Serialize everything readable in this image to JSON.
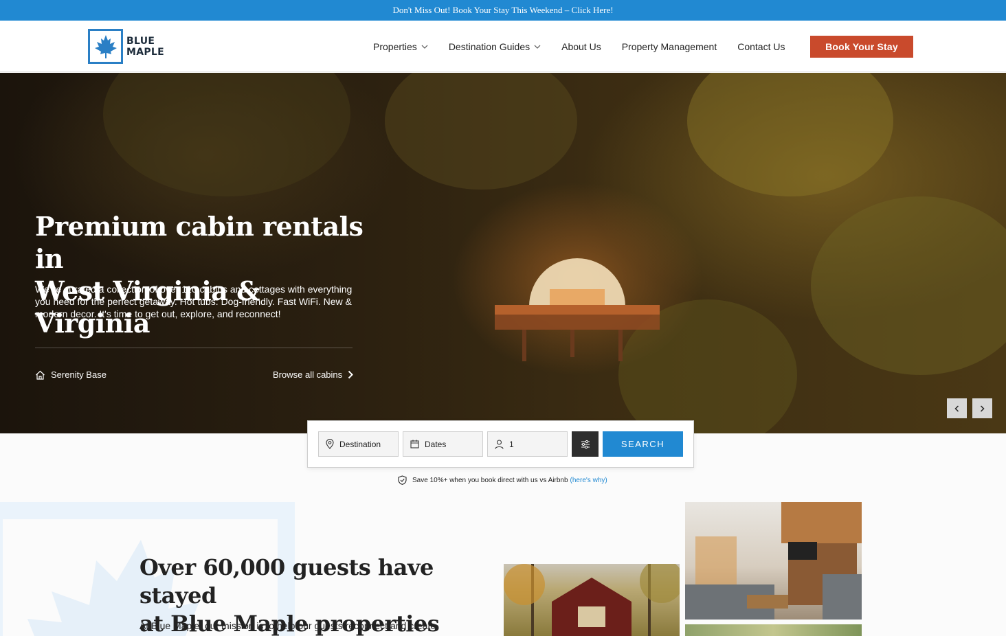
{
  "promo": {
    "text": "Don't Miss Out! Book Your Stay This Weekend – Click Here!"
  },
  "brand": {
    "line1": "BLUE",
    "line2": "MAPLE",
    "accent": "#2a7fc5"
  },
  "nav": {
    "items": [
      {
        "label": "Properties",
        "dropdown": true
      },
      {
        "label": "Destination Guides",
        "dropdown": true
      },
      {
        "label": "About Us",
        "dropdown": false
      },
      {
        "label": "Property Management",
        "dropdown": false
      },
      {
        "label": "Contact Us",
        "dropdown": false
      }
    ],
    "cta": "Book Your Stay",
    "cta_color": "#c94a2c"
  },
  "hero": {
    "title_line1": "Premium cabin rentals in",
    "title_line2": "West Virginia & Virginia",
    "subtitle": "We've curated a collection of over 110 cabins and cottages with everything you need for the perfect getaway. Hot tubs. Dog-friendly. Fast WiFi. New & modern decor. It's time to get out, explore, and reconnect!",
    "property_name": "Serenity Base",
    "browse_label": "Browse all cabins"
  },
  "search": {
    "destination": "Destination",
    "dates": "Dates",
    "guests": "1",
    "button": "SEARCH",
    "button_color": "#2189d2"
  },
  "savings": {
    "text": "Save 10%+ when you book direct with us vs Airbnb",
    "link": "(here's why)"
  },
  "about": {
    "title_line1": "Over 60,000 guests have stayed",
    "title_line2": "at Blue Maple properties",
    "text": "At Blue Maple, our mission is to help our guests reconnect and create"
  }
}
